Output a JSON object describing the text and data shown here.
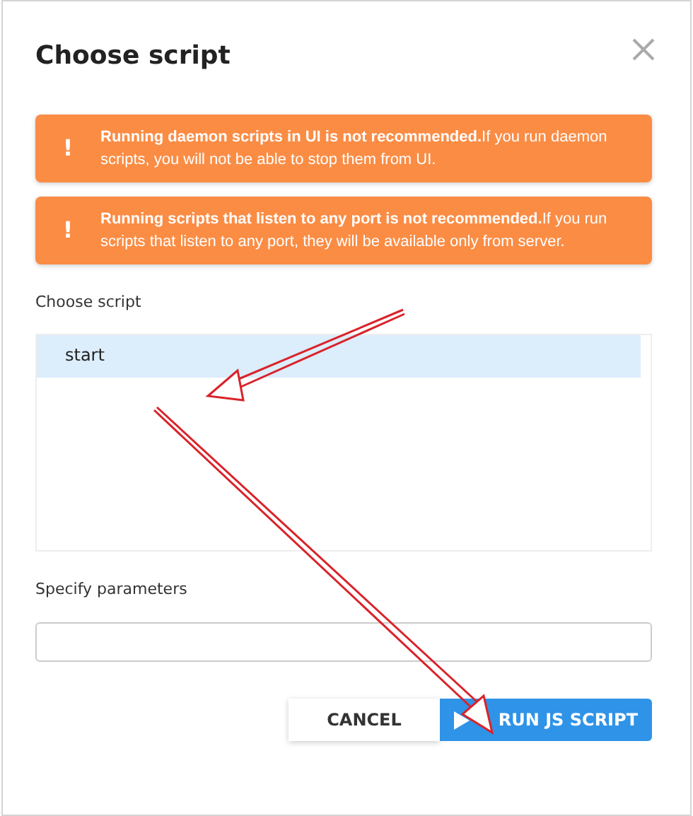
{
  "dialog": {
    "title": "Choose script"
  },
  "alerts": [
    {
      "icon": "!",
      "text": "**Running daemon scripts in UI is not recommended.**If you run daemon scripts, you will not be able to stop them from UI."
    },
    {
      "icon": "!",
      "text": "**Running scripts that listen to any port is not recommended.**If you run scripts that listen to any port, they will be available only from server."
    }
  ],
  "script_list": {
    "label": "Choose script",
    "items": [
      {
        "label": "start",
        "selected": true
      }
    ]
  },
  "parameters": {
    "label": "Specify parameters"
  },
  "buttons": [
    {
      "label": "CANCEL",
      "kind": "secondary"
    },
    {
      "label": "RUN JS SCRIPT",
      "kind": "primary"
    }
  ]
}
